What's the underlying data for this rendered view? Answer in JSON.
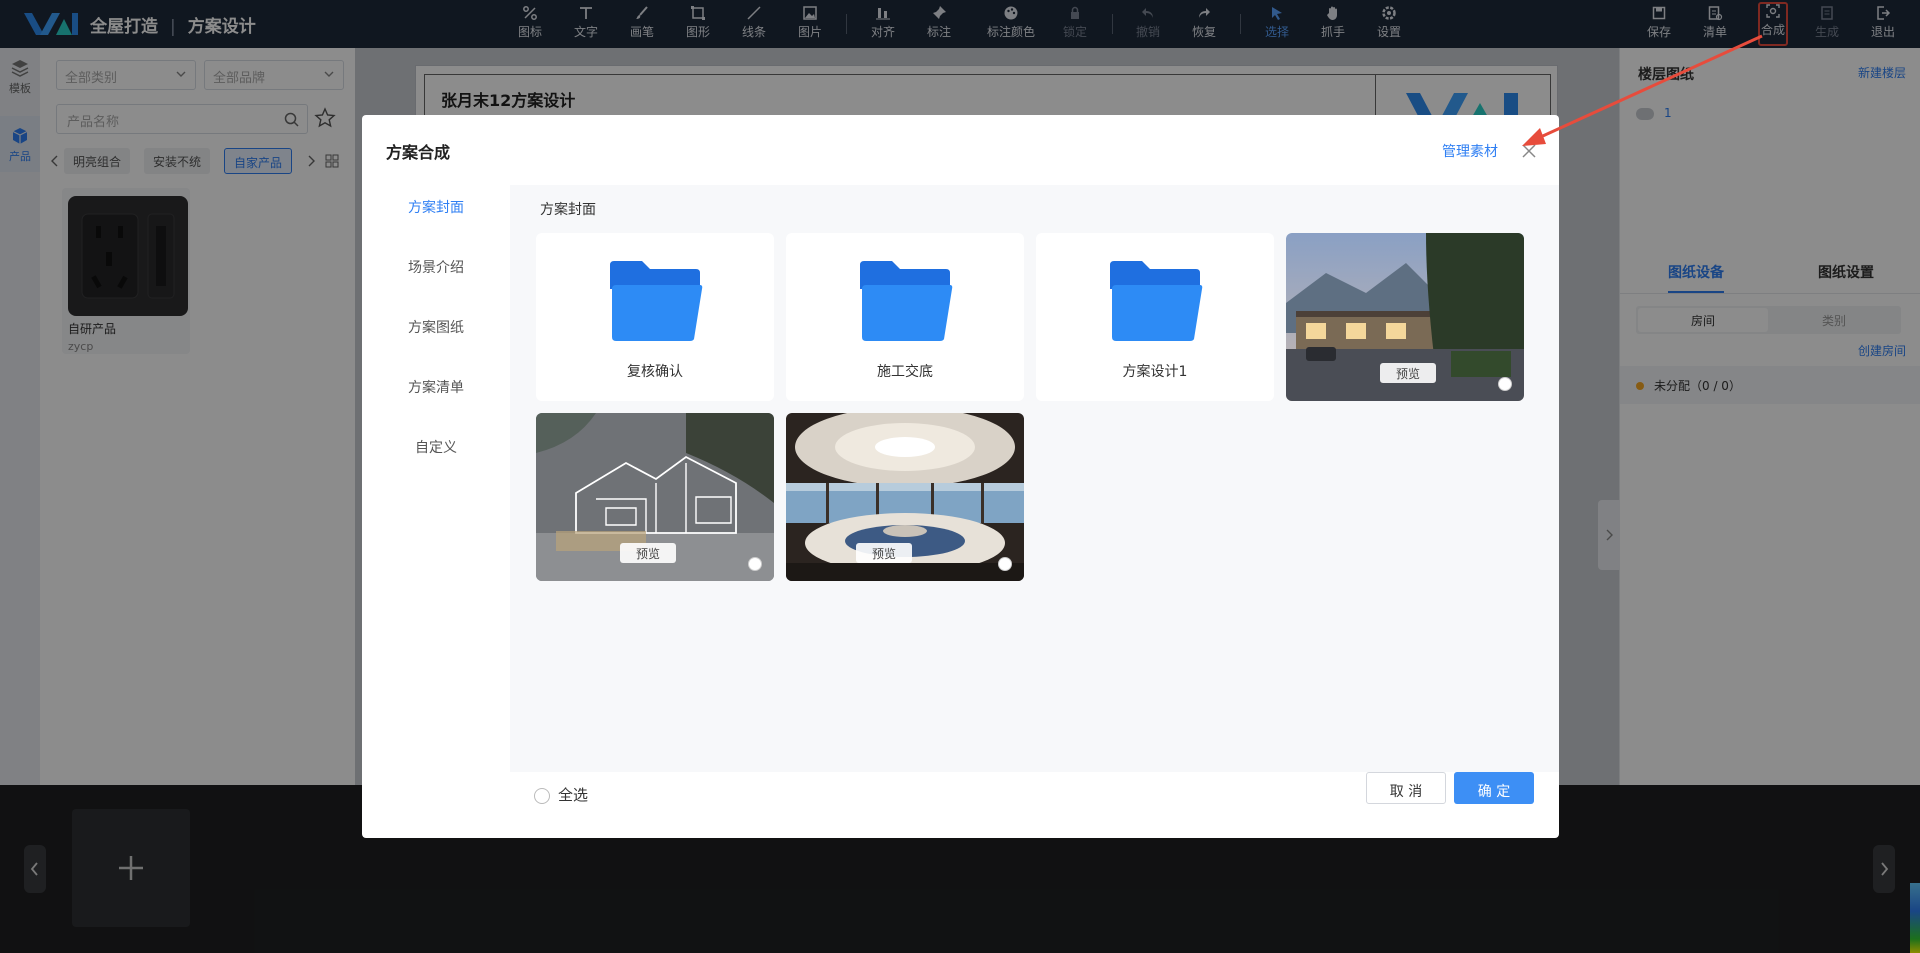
{
  "app": {
    "brand": "全屋打造",
    "page": "方案设计"
  },
  "toolbar": {
    "tools": [
      {
        "icon": "percent-icon",
        "label": "图标"
      },
      {
        "icon": "text-icon",
        "label": "文字"
      },
      {
        "icon": "brush-icon",
        "label": "画笔"
      },
      {
        "icon": "shape-icon",
        "label": "图形"
      },
      {
        "icon": "line-icon",
        "label": "线条"
      },
      {
        "icon": "image-icon",
        "label": "图片"
      },
      {
        "icon": "align-icon",
        "label": "对齐"
      },
      {
        "icon": "pin-icon",
        "label": "标注"
      },
      {
        "icon": "palette-icon",
        "label": "标注颜色"
      },
      {
        "icon": "lock-icon",
        "label": "锁定"
      },
      {
        "icon": "undo-icon",
        "label": "撤销"
      },
      {
        "icon": "redo-icon",
        "label": "恢复"
      },
      {
        "icon": "cursor-icon",
        "label": "选择"
      },
      {
        "icon": "hand-icon",
        "label": "抓手"
      },
      {
        "icon": "gear-icon",
        "label": "设置"
      }
    ],
    "right": [
      {
        "icon": "save-icon",
        "label": "保存"
      },
      {
        "icon": "list-icon",
        "label": "清单"
      },
      {
        "icon": "compose-icon",
        "label": "合成"
      },
      {
        "icon": "generate-icon",
        "label": "生成"
      },
      {
        "icon": "exit-icon",
        "label": "退出"
      }
    ]
  },
  "leftrail": {
    "items": [
      {
        "icon": "layers-icon",
        "label": "模板"
      },
      {
        "icon": "box-icon",
        "label": "产品"
      }
    ]
  },
  "leftpanel": {
    "category_select": "全部类别",
    "brand_select": "全部品牌",
    "search_placeholder": "产品名称",
    "chips": [
      "明亮组合",
      "安装不统",
      "自家产品"
    ],
    "product": {
      "name": "自研产品",
      "code": "zycp"
    }
  },
  "canvas": {
    "paper_title": "张月末12方案设计"
  },
  "rightpanel": {
    "floors_title": "楼层图纸",
    "new_floor": "新建楼层",
    "floor_item": "1",
    "tabs": [
      "图纸设备",
      "图纸设置"
    ],
    "segments": [
      "房间",
      "类别"
    ],
    "create_room": "创建房间",
    "unassigned": "未分配（0 / 0）"
  },
  "modal": {
    "title": "方案合成",
    "manage": "管理素材",
    "nav": [
      "方案封面",
      "场景介绍",
      "方案图纸",
      "方案清单",
      "自定义"
    ],
    "section": "方案封面",
    "folders": [
      "复核确认",
      "施工交底",
      "方案设计1"
    ],
    "preview_label": "预览",
    "select_all": "全选",
    "cancel": "取 消",
    "ok": "确 定"
  },
  "colors": {
    "accent": "#2f7ff3",
    "topbar": "#1e2a3b",
    "highlight": "#e74c3c"
  }
}
